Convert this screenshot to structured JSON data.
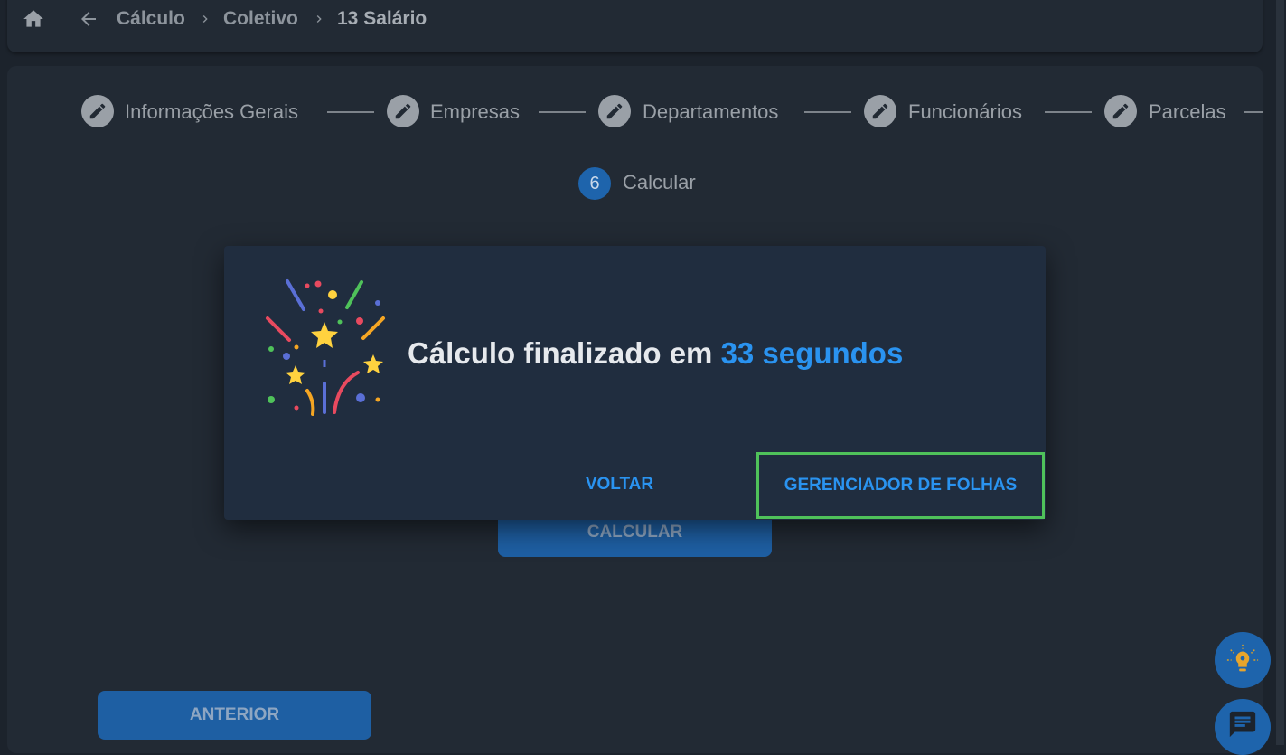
{
  "breadcrumb": {
    "items": [
      "Cálculo",
      "Coletivo",
      "13 Salário"
    ]
  },
  "stepper": {
    "steps": [
      {
        "label": "Informações Gerais",
        "icon": "pencil-icon"
      },
      {
        "label": "Empresas",
        "icon": "pencil-icon"
      },
      {
        "label": "Departamentos",
        "icon": "pencil-icon"
      },
      {
        "label": "Funcionários",
        "icon": "pencil-icon"
      },
      {
        "label": "Parcelas",
        "icon": "pencil-icon"
      }
    ],
    "current": {
      "number": "6",
      "label": "Calcular"
    }
  },
  "buttons": {
    "calcular": "CALCULAR",
    "anterior": "ANTERIOR"
  },
  "dialog": {
    "message_prefix": "Cálculo finalizado em ",
    "message_highlight": "33 segundos",
    "voltar": "VOLTAR",
    "gerenciador": "GERENCIADOR DE FOLHAS"
  },
  "fabs": [
    {
      "icon": "lightbulb-icon"
    },
    {
      "icon": "chat-icon"
    }
  ],
  "colors": {
    "background": "#1c232c",
    "panel": "#222a34",
    "dialog": "#202d3f",
    "accent": "#2a93f0",
    "primary_button": "#1e5fa3",
    "highlight_border": "#4fc25a"
  }
}
